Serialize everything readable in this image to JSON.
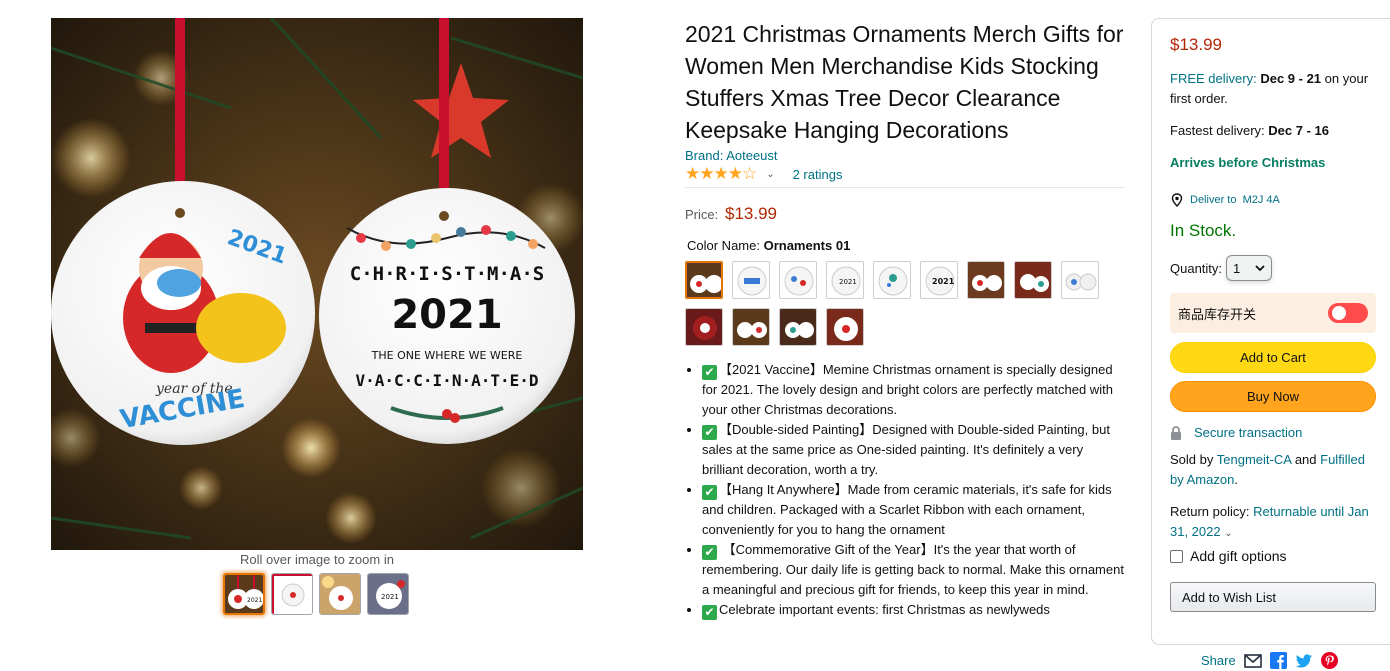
{
  "gallery": {
    "zoom_hint": "Roll over image to zoom in",
    "main_image_icon": "christmas-ornaments-photo",
    "main_image_text": {
      "left_year": "2021",
      "left_caption_small": "year of the",
      "left_caption_big": "VACCINE",
      "right_top": "C·H·R·I·S·T·M·A·S",
      "right_year": "2021",
      "right_line1": "THE ONE WHERE WE WERE",
      "right_line2": "VACCINATED"
    }
  },
  "product": {
    "title": "2021 Christmas Ornaments Merch Gifts for Women Men Merchandise Kids Stocking Stuffers Xmas Tree Decor Clearance Keepsake Hanging Decorations",
    "brand": "Brand: Aoteeust",
    "stars": "★★★★☆",
    "rating": 4,
    "ratings_count": "2 ratings",
    "price_label": "Price:",
    "price": "$13.99",
    "color_label": "Color Name:",
    "color_value": "Ornaments 01",
    "bullets": [
      {
        "text": "【2021 Vaccine】Memine Christmas ornament is specially designed for 2021. The lovely design and bright colors are perfectly matched with your other Christmas decorations."
      },
      {
        "text": "【Double-sided Painting】Designed with Double-sided Painting, but sales at the same price as One-sided painting. It's definitely a very brilliant decoration, worth a try."
      },
      {
        "text": "【Hang It Anywhere】Made from ceramic materials, it's safe for kids and children. Packaged with a Scarlet Ribbon with each ornament, conveniently for you to hang the ornament"
      },
      {
        "text": " 【Commemorative Gift of the Year】It's the year that worth of remembering. Our daily life is getting back to normal. Make this ornament a meaningful and precious gift for friends, to keep this year in mind."
      },
      {
        "text": "Celebrate important events: first Christmas as newlyweds"
      }
    ],
    "check_glyph": "✔"
  },
  "buybox": {
    "price": "$13.99",
    "free_delivery_label": "FREE delivery:",
    "free_delivery_dates": "Dec 9 - 21",
    "free_delivery_suffix": "on your first order.",
    "fastest_label": "Fastest delivery:",
    "fastest_dates": "Dec 7 - 16",
    "arrives": "Arrives before Christmas",
    "deliver_to": "Deliver to",
    "postal_code": "M2J 4A",
    "stock": "In Stock.",
    "quantity_label": "Quantity:",
    "quantity_value": "1",
    "stock_toggle_label": "商品库存开关",
    "add_to_cart": "Add to Cart",
    "buy_now": "Buy Now",
    "secure": "Secure transaction",
    "sold_by_label": "Sold by",
    "sold_by": "Tengmeit-CA",
    "sold_and": "and",
    "fulfilled_by": "Fulfilled by Amazon",
    "period": ".",
    "return_label": "Return policy:",
    "return_value": "Returnable until Jan 31, 2022",
    "gift_options": "Add gift options",
    "wish_list": "Add to Wish List",
    "share": "Share"
  }
}
